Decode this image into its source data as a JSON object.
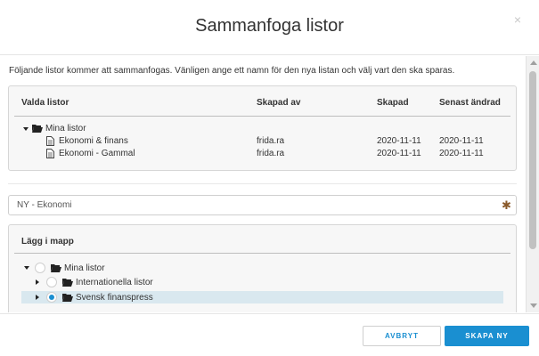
{
  "modal": {
    "title": "Sammanfoga listor",
    "close": "×",
    "intro": "Följande listor kommer att sammanfogas. Vänligen ange ett namn för den nya listan och välj vart den ska sparas."
  },
  "lists_table": {
    "headers": {
      "name": "Valda listor",
      "created_by": "Skapad av",
      "created": "Skapad",
      "modified": "Senast ändrad"
    },
    "folder": "Mina listor",
    "rows": [
      {
        "name": "Ekonomi & finans",
        "created_by": "frida.ra",
        "created": "2020-11-11",
        "modified": "2020-11-11"
      },
      {
        "name": "Ekonomi - Gammal",
        "created_by": "frida.ra",
        "created": "2020-11-11",
        "modified": "2020-11-11"
      }
    ]
  },
  "new_list": {
    "value": "NY - Ekonomi",
    "required_mark": "✱"
  },
  "folder_picker": {
    "title": "Lägg i mapp",
    "items": [
      {
        "label": "Mina listor",
        "expanded": true,
        "selected": false
      },
      {
        "label": "Internationella listor",
        "expanded": false,
        "selected": false
      },
      {
        "label": "Svensk finanspress",
        "expanded": false,
        "selected": true
      }
    ]
  },
  "footer": {
    "cancel_label": "AVBRYT",
    "create_label": "SKAPA NY"
  },
  "colors": {
    "accent": "#1a8fd1",
    "highlight_row": "#d9e8ef",
    "required": "#8a5a2b"
  }
}
